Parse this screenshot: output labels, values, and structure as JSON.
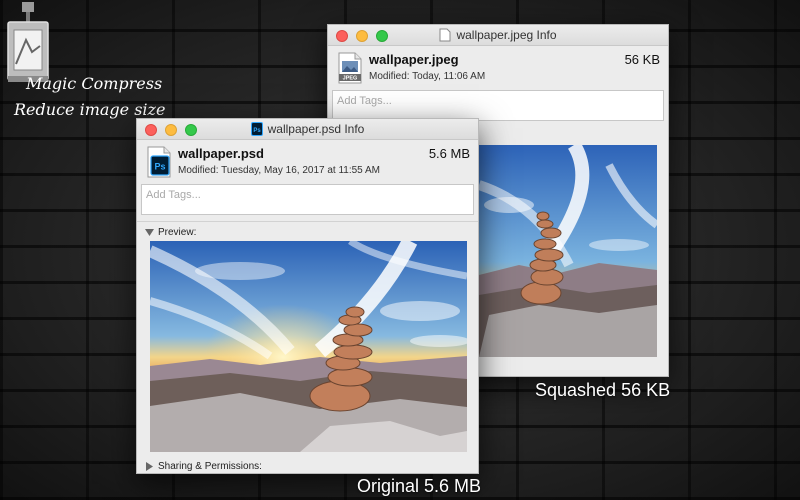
{
  "branding": {
    "app_name": "Magic Compress",
    "tagline": "Reduce image size",
    "icon": "compressor-machine-icon"
  },
  "jpeg_window": {
    "title": "wallpaper.jpeg Info",
    "file_name": "wallpaper.jpeg",
    "modified": "Modified: Today, 11:06 AM",
    "size": "56 KB",
    "tags_placeholder": "Add Tags...",
    "icon_badge": "JPEG",
    "icon": "jpeg-file-icon"
  },
  "psd_window": {
    "title": "wallpaper.psd Info",
    "file_name": "wallpaper.psd",
    "modified": "Modified: Tuesday, May 16, 2017 at 11:55 AM",
    "size": "5.6 MB",
    "tags_placeholder": "Add Tags...",
    "icon_badge": "Ps",
    "icon": "photoshop-file-icon",
    "preview_label": "Preview:",
    "sharing_label": "Sharing & Permissions:"
  },
  "captions": {
    "compressed": "Squashed 56 KB",
    "original": "Original 5.6 MB"
  },
  "colors": {
    "close": "#fc605c",
    "minimize": "#fdbc40",
    "zoom": "#34c84a",
    "photoshop_blue": "#31a8ff"
  }
}
